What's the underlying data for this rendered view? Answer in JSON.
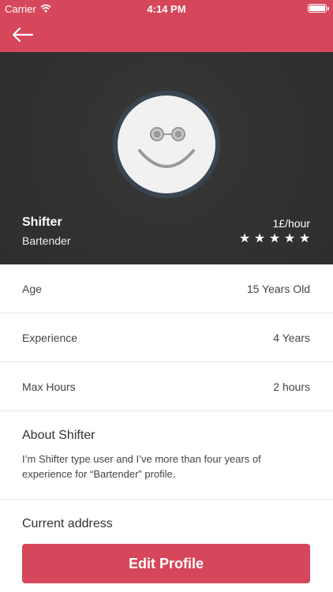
{
  "status_bar": {
    "carrier": "Carrier",
    "time": "4:14 PM"
  },
  "icons": {
    "back": "back-arrow-icon",
    "wifi": "wifi-icon",
    "battery": "battery-icon",
    "avatar": "smiley-avatar-icon",
    "star": "star-icon"
  },
  "colors": {
    "accent": "#d6475b",
    "hero_bg": "#333333",
    "divider": "#e6e6e6"
  },
  "profile": {
    "name": "Shifter",
    "role": "Bartender",
    "rate": "1£/hour",
    "rating_stars": 5,
    "rating_max": 5
  },
  "details": {
    "age": {
      "label": "Age",
      "value": "15 Years Old"
    },
    "experience": {
      "label": "Experience",
      "value": "4 Years"
    },
    "max_hours": {
      "label": "Max Hours",
      "value": "2 hours"
    }
  },
  "about": {
    "title": "About Shifter",
    "text": "I’m Shifter type user and I’ve more than four years of experience for “Bartender” profile."
  },
  "address": {
    "title": "Current address"
  },
  "actions": {
    "edit_profile": "Edit Profile"
  }
}
